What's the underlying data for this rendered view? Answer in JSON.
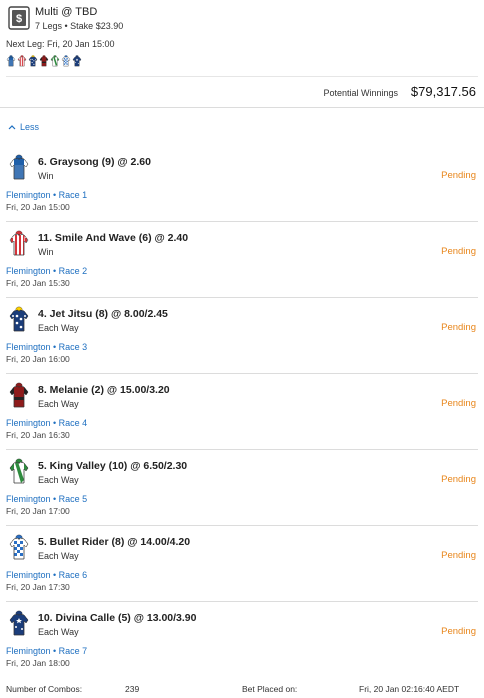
{
  "bet": {
    "title": "Multi @ TBD",
    "subtitle": "7 Legs • Stake $23.90",
    "next_leg": "Next Leg: Fri, 20 Jan 15:00",
    "icon": "receipt-dollar-icon",
    "potential_label": "Potential Winnings",
    "potential_value": "$79,317.56",
    "less_label": "Less"
  },
  "legs": [
    {
      "runner": "6. Graysong (9) @ 2.60",
      "bet_type": "Win",
      "status": "Pending",
      "venue": "Flemington • Race 1",
      "time": "Fri, 20 Jan 15:00",
      "silk": "blue-white-sleeves"
    },
    {
      "runner": "11. Smile And Wave (6) @ 2.40",
      "bet_type": "Win",
      "status": "Pending",
      "venue": "Flemington • Race 2",
      "time": "Fri, 20 Jan 15:30",
      "silk": "red-white-stripes"
    },
    {
      "runner": "4. Jet Jitsu (8) @ 8.00/2.45",
      "bet_type": "Each Way",
      "status": "Pending",
      "venue": "Flemington • Race 3",
      "time": "Fri, 20 Jan 16:00",
      "silk": "navy-white-spots"
    },
    {
      "runner": "8. Melanie (2) @ 15.00/3.20",
      "bet_type": "Each Way",
      "status": "Pending",
      "venue": "Flemington • Race 4",
      "time": "Fri, 20 Jan 16:30",
      "silk": "maroon-black"
    },
    {
      "runner": "5. King Valley (10) @ 6.50/2.30",
      "bet_type": "Each Way",
      "status": "Pending",
      "venue": "Flemington • Race 5",
      "time": "Fri, 20 Jan 17:00",
      "silk": "green-white-sash"
    },
    {
      "runner": "5. Bullet Rider (8) @ 14.00/4.20",
      "bet_type": "Each Way",
      "status": "Pending",
      "venue": "Flemington • Race 6",
      "time": "Fri, 20 Jan 17:30",
      "silk": "blue-white-checks"
    },
    {
      "runner": "10. Divina Calle (5) @ 13.00/3.90",
      "bet_type": "Each Way",
      "status": "Pending",
      "venue": "Flemington • Race 7",
      "time": "Fri, 20 Jan 18:00",
      "silk": "navy-white-stars"
    }
  ],
  "footer": {
    "combos_label": "Number of Combos:",
    "combos_value": "239",
    "placed_label": "Bet Placed on:",
    "placed_value": "Fri, 20 Jan 02:16:40 AEDT"
  },
  "colors": {
    "accent_blue": "#1e6fc0",
    "pending_orange": "#e8861b",
    "divider": "#dcdcdc"
  }
}
